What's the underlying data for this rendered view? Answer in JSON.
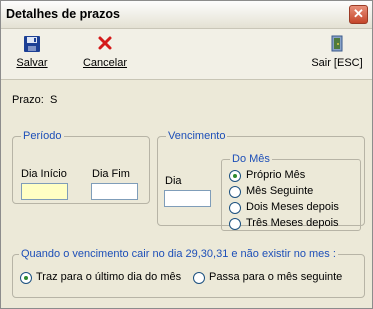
{
  "window": {
    "title": "Detalhes de prazos",
    "close_icon": "close-icon"
  },
  "toolbar": {
    "save": {
      "label": "Salvar",
      "icon": "floppy-disk-icon",
      "color": "#1c3f94"
    },
    "cancel": {
      "label": "Cancelar",
      "icon": "red-x-icon",
      "color": "#d41a1a"
    },
    "exit": {
      "label": "Sair [ESC]",
      "icon": "exit-door-icon"
    }
  },
  "prazo": {
    "label": "Prazo:",
    "value": "S"
  },
  "periodo": {
    "legend": "Período",
    "dia_inicio": {
      "label": "Dia Início",
      "value": ""
    },
    "dia_fim": {
      "label": "Dia Fim",
      "value": ""
    }
  },
  "vencimento": {
    "legend": "Vencimento",
    "dia": {
      "label": "Dia",
      "value": ""
    },
    "do_mes": {
      "legend": "Do Mês",
      "options": [
        "Próprio Mês",
        "Mês Seguinte",
        "Dois Meses depois",
        "Três Meses depois"
      ],
      "selected_index": 0
    }
  },
  "dia_inexistente": {
    "legend": "Quando o vencimento cair no dia 29,30,31 e não existir no mes :",
    "options": [
      "Traz para o último dia do mês",
      "Passa para o mês seguinte"
    ],
    "selected_index": 0
  },
  "colors": {
    "accent_text": "#1d4fb8",
    "active_input": "#ffffc4"
  }
}
